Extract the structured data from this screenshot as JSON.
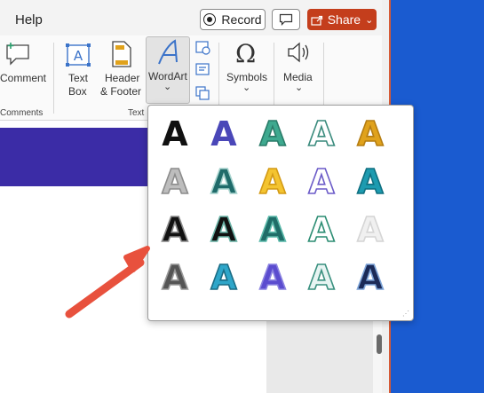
{
  "titlebar": {
    "help_label": "Help",
    "record_label": "Record",
    "share_label": "Share"
  },
  "ribbon": {
    "comment_label": "Comment",
    "comments_group": "Comments",
    "textbox_line1": "Text",
    "textbox_line2": "Box",
    "header_line1": "Header",
    "header_line2": "& Footer",
    "wordart_label": "WordArt",
    "text_group": "Text",
    "symbols_label": "Symbols",
    "media_label": "Media",
    "chevron": "⌄"
  },
  "gallery": {
    "glyph": "A",
    "styles": [
      {
        "fill": "#111111",
        "stroke": "none"
      },
      {
        "fill": "#4a47b8",
        "stroke": "none"
      },
      {
        "fill": "#3ea98f",
        "stroke": "#2a7c69"
      },
      {
        "fill": "#ffffff",
        "stroke": "#3a8b7d"
      },
      {
        "fill": "#e0a21c",
        "stroke": "#b57d12"
      },
      {
        "fill": "#bdbdbd",
        "stroke": "#8c8c8c"
      },
      {
        "fill": "#1f6b6a",
        "stroke": "#a7d3ce"
      },
      {
        "fill": "#f4c430",
        "stroke": "#d39a15"
      },
      {
        "fill": "#ffffff",
        "stroke": "#6b5bc8"
      },
      {
        "fill": "#1d9bb0",
        "stroke": "#0f6f80"
      },
      {
        "fill": "#111111",
        "stroke": "#8a8a8a"
      },
      {
        "fill": "#111111",
        "stroke": "#6ab2a6"
      },
      {
        "fill": "#1f6d68",
        "stroke": "#5ab9aa"
      },
      {
        "fill": "#ffffff",
        "stroke": "#2c8d73"
      },
      {
        "fill": "#f0f0f0",
        "stroke": "#d5d5d5"
      },
      {
        "fill": "#555555",
        "stroke": "#999999"
      },
      {
        "fill": "#2ea6c9",
        "stroke": "#1b6c85"
      },
      {
        "fill": "#5b4ccf",
        "stroke": "#8a82e0"
      },
      {
        "fill": "#e7f4f2",
        "stroke": "#39907f"
      },
      {
        "fill": "#1b2a57",
        "stroke": "#7da4d8"
      }
    ]
  },
  "colors": {
    "share": "#c43e1c",
    "desktop": "#1a5bd0",
    "slide_band": "#3b2ca6",
    "arrow": "#e8513d"
  },
  "icons": [
    "record-icon",
    "comment-icon",
    "share-icon",
    "wordart-icon",
    "symbols-icon",
    "media-icon",
    "pointer-arrow"
  ]
}
